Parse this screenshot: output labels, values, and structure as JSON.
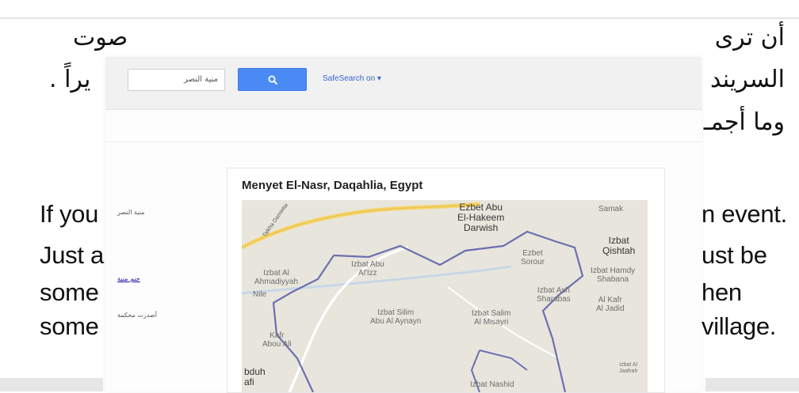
{
  "slide": {
    "arabic_line1_left": "أن ترى",
    "arabic_line1_right": "صوت",
    "arabic_line2_left": "السريند",
    "arabic_line2_right": "يراً .",
    "arabic_line3_left": "وما أجمـ",
    "english_left": [
      "If you",
      "Just a",
      "some",
      "some"
    ],
    "english_right": [
      "n event.",
      "ust be",
      "hen",
      "village."
    ]
  },
  "search": {
    "query": "منية النصر",
    "safesearch_label": "SafeSearch on ▾"
  },
  "sidebar": {
    "item1": "منية النصر",
    "item2": "جنم منية",
    "item3": "أصدرت محكمة"
  },
  "map": {
    "title": "Menyet El-Nasr, Daqahlia, Egypt",
    "labels": {
      "hakeem": "Ezbet Abu\nEl-Hakeem\nDarwish",
      "samak": "Samak",
      "qishtah": "Izbat\nQishtah",
      "sorour": "Ezbet\nSorour",
      "hamdy": "Izbat Hamdy\nShabana",
      "ahmadiyyah": "Izbat Al\nAhmadiyyah",
      "abualizz": "Izbat Abu\nAl'Izz",
      "nile": "Nile",
      "ashsharabas": "Izbat Ash\nSharabas",
      "alkafr": "Al Kafr\nAl Jadid",
      "silim": "Izbat Silim\nAbu Al Aynayn",
      "salim": "Izbat Salim\nAl Misayri",
      "kafr": "Kafr\nAbou Ali",
      "bduh": "bduh\nafi",
      "jaafrah": "Izbat Al\nJaafrah",
      "nashid": "Izbat Nashid",
      "road": "Talkha Damietta"
    }
  },
  "colors": {
    "search_button": "#4a8af4",
    "link": "#1a0dab",
    "map_bg": "#e8e6dc",
    "boundary": "#6b6fb0",
    "road": "#f6d46b"
  }
}
